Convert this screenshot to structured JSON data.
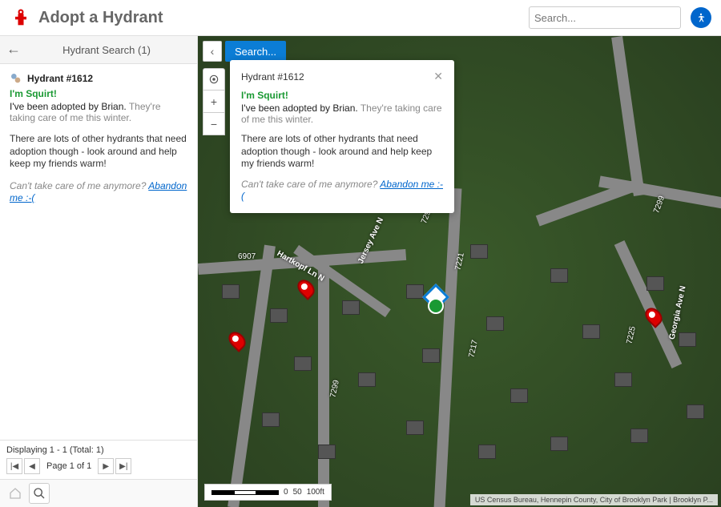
{
  "app": {
    "title": "Adopt a Hydrant"
  },
  "topSearch": {
    "placeholder": "Search..."
  },
  "sidebar": {
    "header": "Hydrant Search (1)",
    "item": {
      "title": "Hydrant #1612",
      "squirt": "I'm Squirt!",
      "adopted_prefix": "I've been adopted by Brian.",
      "adopted_suffix": " They're taking care of me this winter.",
      "para1": "There are lots of other hydrants that need adoption though - look around and help keep my friends warm!",
      "care": "Can't take care of me anymore? ",
      "abandon": "Abandon me :-("
    },
    "footer": {
      "displaying": "Displaying 1 - 1 (Total: 1)",
      "pageText": "Page 1 of 1"
    }
  },
  "mapSearch": {
    "label": "Search..."
  },
  "popup": {
    "title": "Hydrant #1612",
    "squirt": "I'm Squirt!",
    "adopted_prefix": "I've been adopted by Brian.",
    "adopted_suffix": " They're taking care of me this winter.",
    "para1": "There are lots of other hydrants that need adoption though - look around and help keep my friends warm!",
    "care": "Can't take care of me anymore? ",
    "abandon": "Abandon me :-("
  },
  "scale": {
    "s0": "0",
    "s1": "50",
    "s2": "100ft"
  },
  "attribution": "US Census Bureau, Hennepin County, City of Brooklyn Park | Brooklyn P...",
  "streets": {
    "hartkopf": "Hartkopf Ln N",
    "jersey": "Jersey Ave N",
    "georgia": "Georgia Ave N"
  },
  "nums": {
    "n6907": "6907",
    "n7299a": "7299",
    "n7299b": "7299",
    "n7299c": "7299",
    "n7221": "7221",
    "n7217": "7217",
    "n7225": "7225"
  }
}
